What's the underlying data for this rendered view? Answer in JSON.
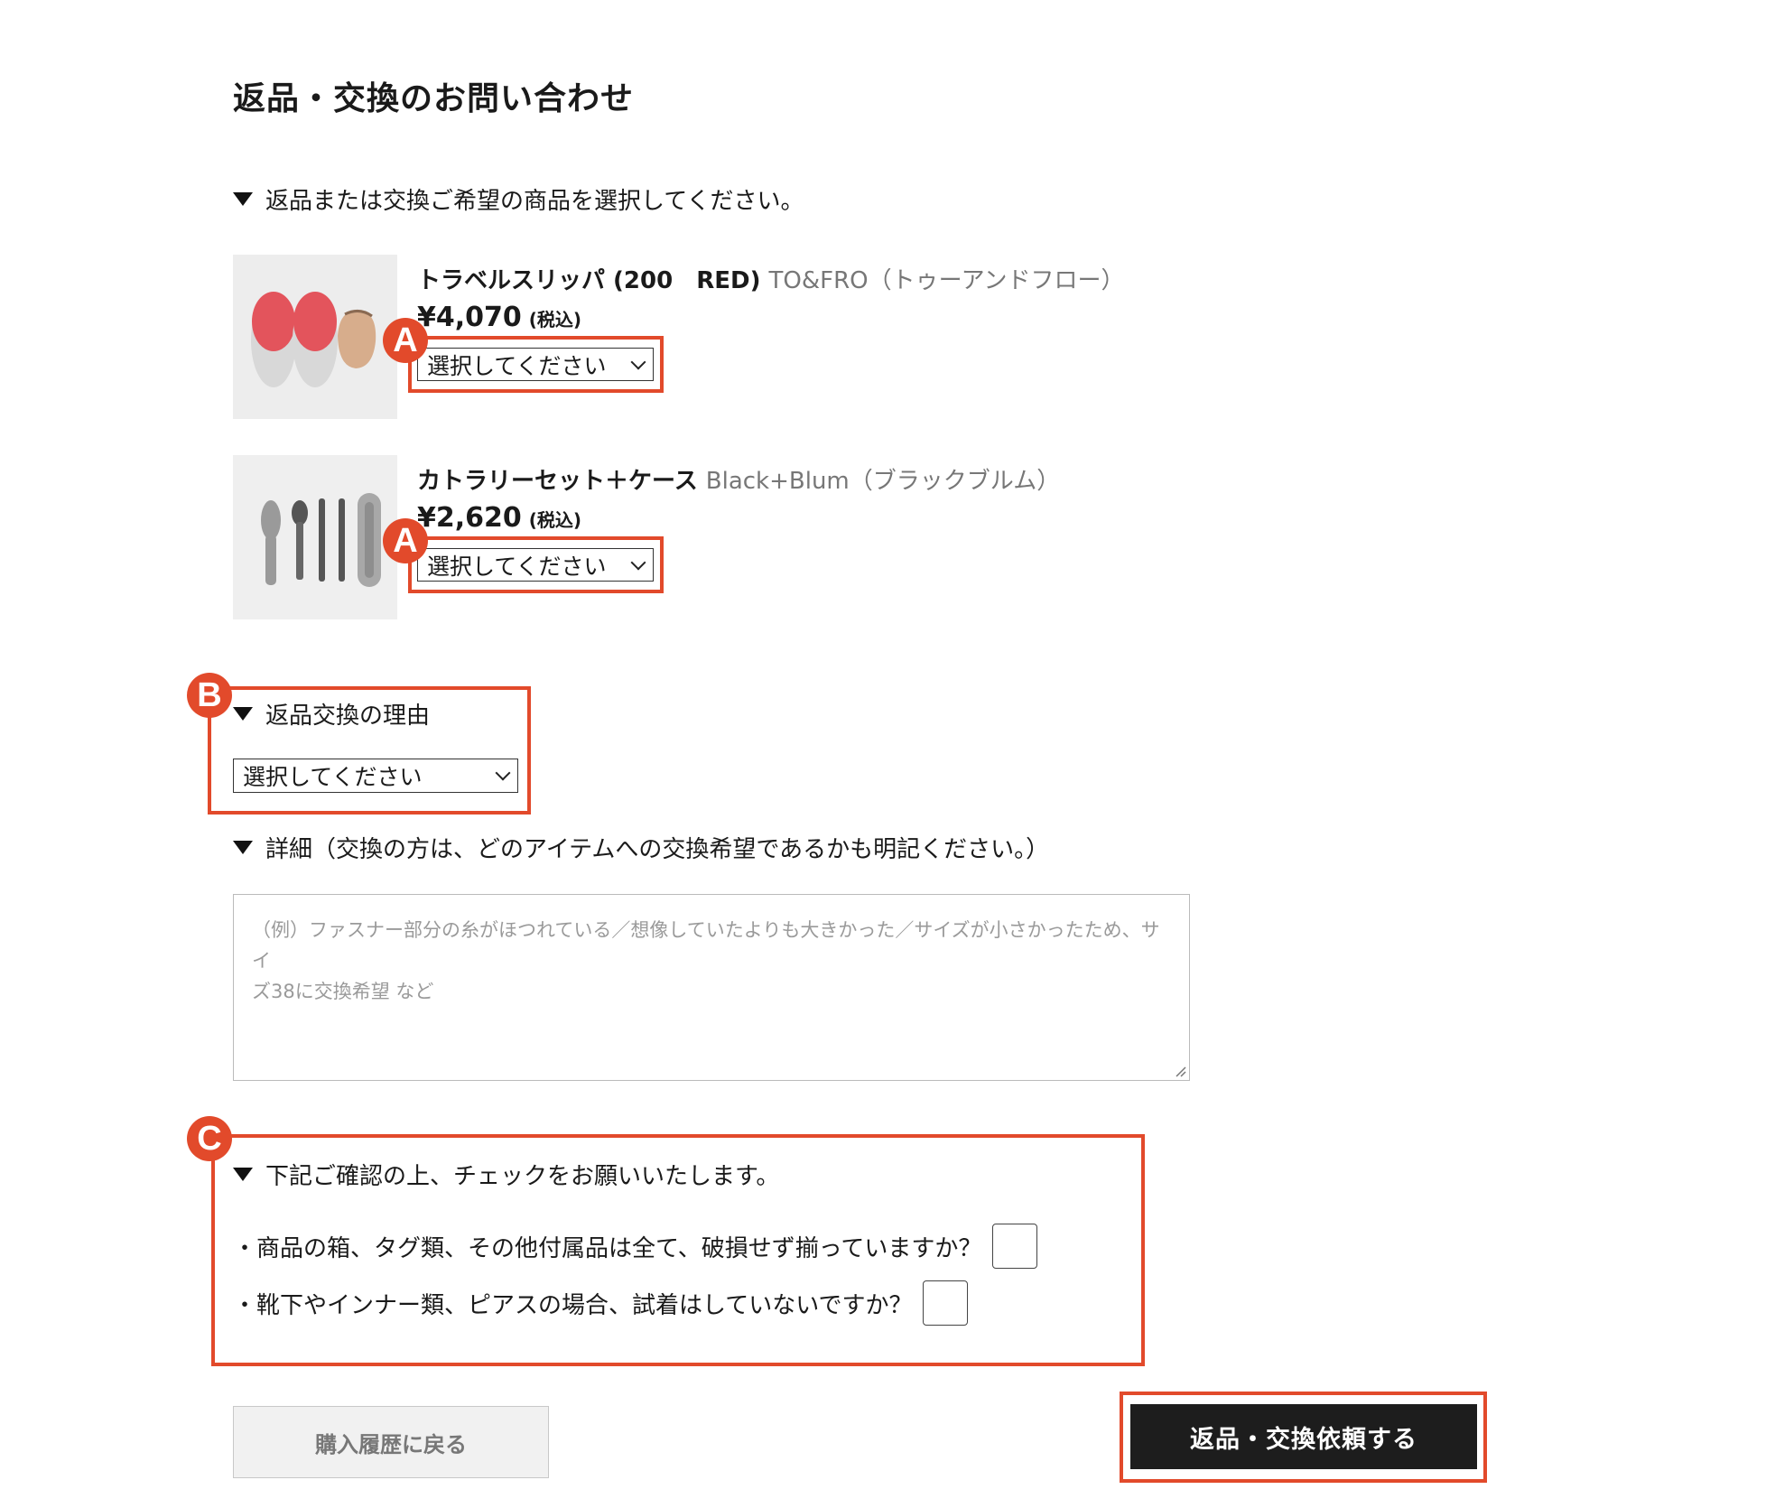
{
  "page": {
    "title": "返品・交換のお問い合わせ"
  },
  "product_section": {
    "heading": "返品または交換ご希望の商品を選択してください。"
  },
  "products": [
    {
      "name": "トラベルスリッパ (200　RED)",
      "brand": "TO&FRO（トゥーアンドフロー）",
      "price": "¥4,070",
      "tax_note": "(税込)",
      "select_value": "選択してください",
      "image": "red-slippers-photo"
    },
    {
      "name": "カトラリーセット＋ケース",
      "brand": "Black+Blum（ブラックブルム）",
      "price": "¥2,620",
      "tax_note": "(税込)",
      "select_value": "選択してください",
      "image": "cutlery-set-photo"
    }
  ],
  "reason": {
    "heading": "返品交換の理由",
    "select_value": "選択してください"
  },
  "details": {
    "heading": "詳細（交換の方は、どのアイテムへの交換希望であるかも明記ください。）",
    "placeholder_line1": "（例）ファスナー部分の糸がほつれている／想像していたよりも大きかった／サイズが小さかったため、サイ",
    "placeholder_line2": "ズ38に交換希望 など"
  },
  "confirm": {
    "heading": "下記ご確認の上、チェックをお願いいたします。",
    "items": [
      {
        "text": "・商品の箱、タグ類、その他付属品は全て、破損せず揃っていますか？",
        "checked": false
      },
      {
        "text": "・靴下やインナー類、ピアスの場合、試着はしていないですか？",
        "checked": false
      }
    ]
  },
  "buttons": {
    "back": "購入履歴に戻る",
    "submit": "返品・交換依頼する"
  },
  "annotations": {
    "a": "A",
    "b": "B",
    "c": "C"
  },
  "colors": {
    "annotation_red": "#e24a2b",
    "submit_bg": "#1d1d1d",
    "back_bg": "#f1f1f1"
  }
}
